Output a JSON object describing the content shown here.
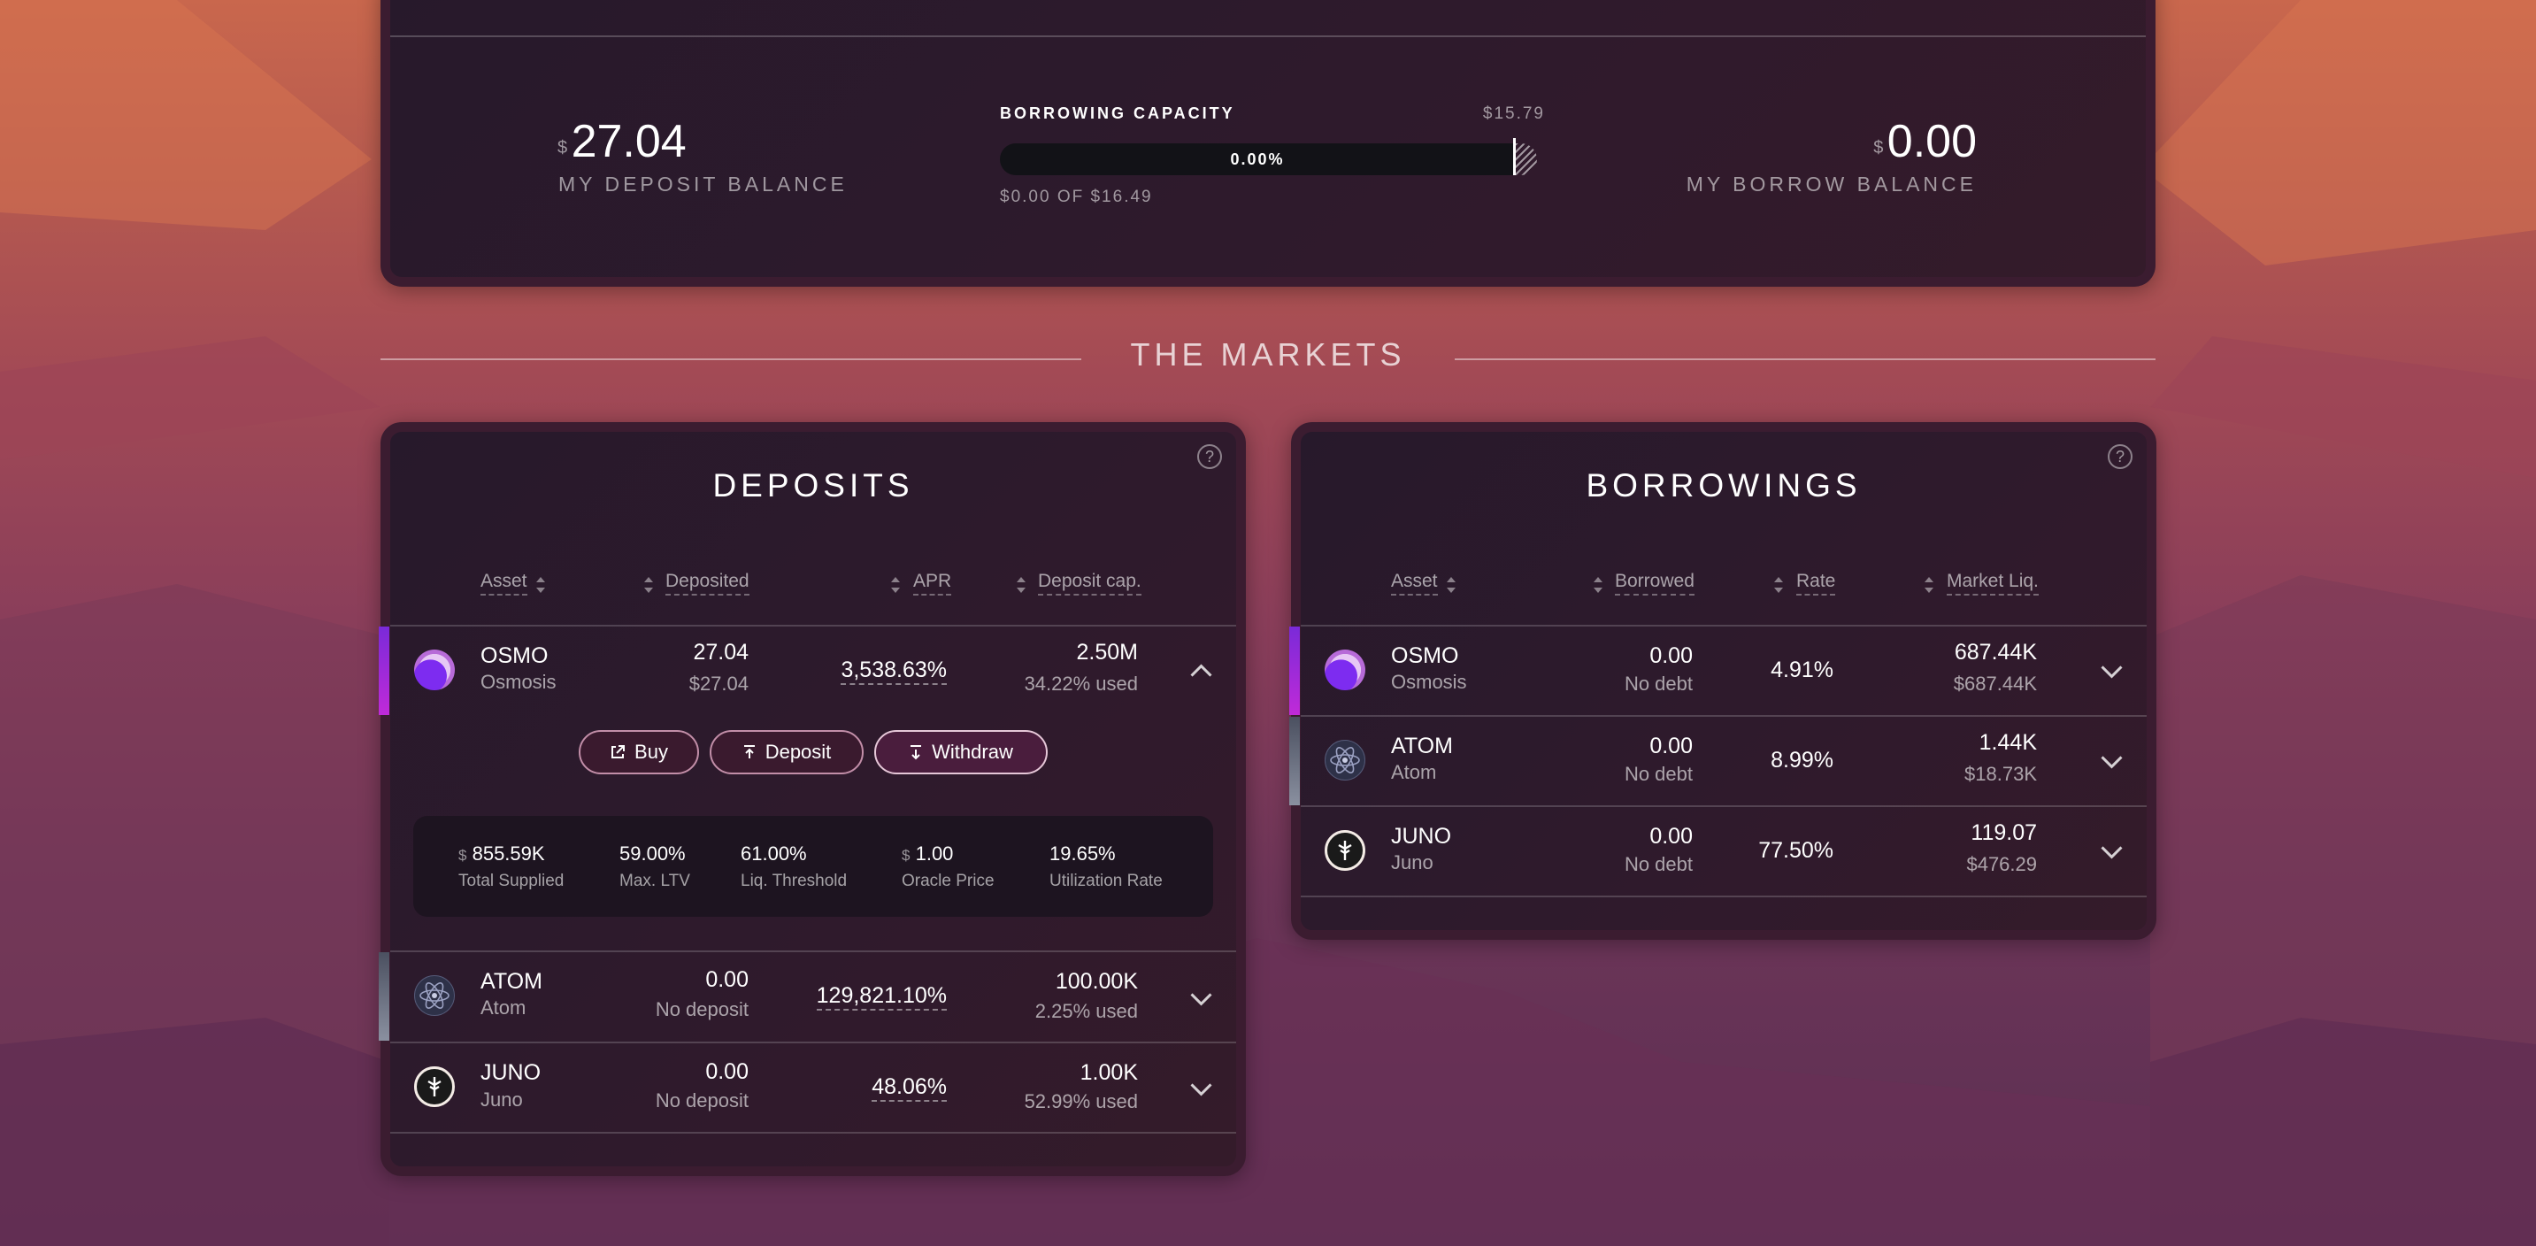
{
  "summary": {
    "deposit_currency": "$",
    "deposit_value": "27.04",
    "deposit_label": "MY DEPOSIT BALANCE",
    "capacity_title": "BORROWING CAPACITY",
    "capacity_limit": "$15.79",
    "capacity_percent": "0.00%",
    "capacity_fill_percent": 0,
    "capacity_sub": "$0.00 OF $16.49",
    "borrow_currency": "$",
    "borrow_value": "0.00",
    "borrow_label": "MY BORROW BALANCE"
  },
  "section_title": "THE MARKETS",
  "deposits": {
    "title": "DEPOSITS",
    "help": "?",
    "columns": [
      "Asset",
      "Deposited",
      "APR",
      "Deposit cap."
    ],
    "rows": [
      {
        "symbol": "OSMO",
        "name": "Osmosis",
        "amount": "27.04",
        "sub": "$27.04",
        "apr": "3,538.63%",
        "cap": "2.50M",
        "cap_used": "34.22% used"
      },
      {
        "symbol": "ATOM",
        "name": "Atom",
        "amount": "0.00",
        "sub": "No deposit",
        "apr": "129,821.10%",
        "cap": "100.00K",
        "cap_used": "2.25% used"
      },
      {
        "symbol": "JUNO",
        "name": "Juno",
        "amount": "0.00",
        "sub": "No deposit",
        "apr": "48.06%",
        "cap": "1.00K",
        "cap_used": "52.99% used"
      }
    ],
    "actions": {
      "buy": "Buy",
      "deposit": "Deposit",
      "withdraw": "Withdraw"
    },
    "details": {
      "total_supplied_cur": "$",
      "total_supplied": "855.59K",
      "total_supplied_label": "Total Supplied",
      "max_ltv": "59.00%",
      "max_ltv_label": "Max. LTV",
      "liq_threshold": "61.00%",
      "liq_threshold_label": "Liq. Threshold",
      "oracle_cur": "$",
      "oracle_price": "1.00",
      "oracle_label": "Oracle Price",
      "utilization": "19.65%",
      "utilization_label": "Utilization Rate"
    }
  },
  "borrowings": {
    "title": "BORROWINGS",
    "help": "?",
    "columns": [
      "Asset",
      "Borrowed",
      "Rate",
      "Market Liq."
    ],
    "rows": [
      {
        "symbol": "OSMO",
        "name": "Osmosis",
        "amount": "0.00",
        "sub": "No debt",
        "rate": "4.91%",
        "liq": "687.44K",
        "liq_usd": "$687.44K"
      },
      {
        "symbol": "ATOM",
        "name": "Atom",
        "amount": "0.00",
        "sub": "No debt",
        "rate": "8.99%",
        "liq": "1.44K",
        "liq_usd": "$18.73K"
      },
      {
        "symbol": "JUNO",
        "name": "Juno",
        "amount": "0.00",
        "sub": "No debt",
        "rate": "77.50%",
        "liq": "119.07",
        "liq_usd": "$476.29"
      }
    ]
  },
  "colors": {
    "osmo_accent": "#a428d8",
    "atom_accent": "#6f7686",
    "juno_accent": "#ffffff"
  },
  "icons": [
    "osmo-icon",
    "atom-icon",
    "juno-icon",
    "external-link-icon",
    "deposit-icon",
    "withdraw-icon",
    "help-icon",
    "chevron-down-icon",
    "chevron-up-icon",
    "sort-icon"
  ]
}
